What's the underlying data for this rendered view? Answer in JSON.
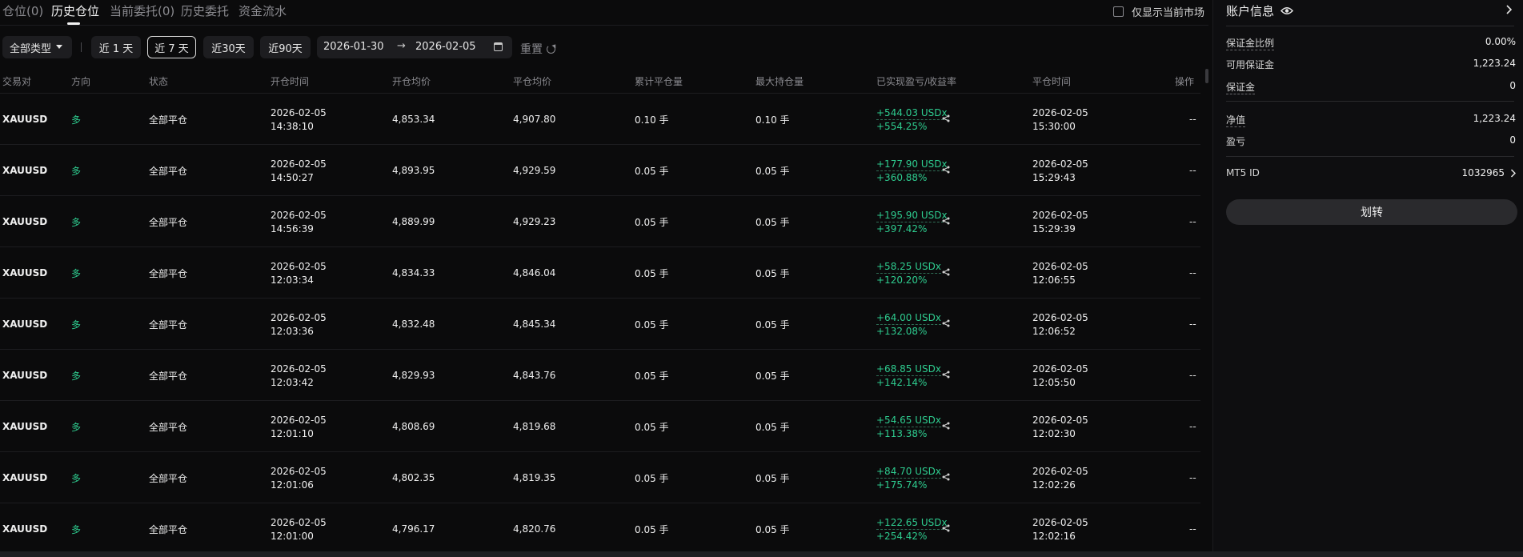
{
  "tabs": [
    {
      "label": "仓位(0)",
      "active": false
    },
    {
      "label": "历史仓位",
      "active": true
    },
    {
      "label": "当前委托(0)",
      "active": false
    },
    {
      "label": "历史委托",
      "active": false
    },
    {
      "label": "资金流水",
      "active": false
    }
  ],
  "only_current_market_label": "仅显示当前市场",
  "filters": {
    "type_select": "全部类型",
    "ranges": [
      "近 1 天",
      "近 7 天",
      "近30天",
      "近90天"
    ],
    "active_range": "近 7 天",
    "date_start": "2026-01-30",
    "date_end": "2026-02-05",
    "reset_label": "重置"
  },
  "table": {
    "headers": [
      "交易对",
      "方向",
      "状态",
      "开仓时间",
      "开仓均价",
      "平仓均价",
      "累计平仓量",
      "最大持仓量",
      "已实现盈亏/收益率",
      "平仓时间",
      "操作"
    ],
    "rows": [
      {
        "pair": "XAUUSD",
        "direction": "多",
        "status": "全部平仓",
        "open_date": "2026-02-05",
        "open_time": "14:38:10",
        "open_avg": "4,853.34",
        "close_avg": "4,907.80",
        "closed_qty": "0.10 手",
        "max_qty": "0.10 手",
        "pnl": "+544.03 USDx",
        "roi": "+554.25%",
        "close_date": "2026-02-05",
        "close_time": "15:30:00",
        "op": "--"
      },
      {
        "pair": "XAUUSD",
        "direction": "多",
        "status": "全部平仓",
        "open_date": "2026-02-05",
        "open_time": "14:50:27",
        "open_avg": "4,893.95",
        "close_avg": "4,929.59",
        "closed_qty": "0.05 手",
        "max_qty": "0.05 手",
        "pnl": "+177.90 USDx",
        "roi": "+360.88%",
        "close_date": "2026-02-05",
        "close_time": "15:29:43",
        "op": "--"
      },
      {
        "pair": "XAUUSD",
        "direction": "多",
        "status": "全部平仓",
        "open_date": "2026-02-05",
        "open_time": "14:56:39",
        "open_avg": "4,889.99",
        "close_avg": "4,929.23",
        "closed_qty": "0.05 手",
        "max_qty": "0.05 手",
        "pnl": "+195.90 USDx",
        "roi": "+397.42%",
        "close_date": "2026-02-05",
        "close_time": "15:29:39",
        "op": "--"
      },
      {
        "pair": "XAUUSD",
        "direction": "多",
        "status": "全部平仓",
        "open_date": "2026-02-05",
        "open_time": "12:03:34",
        "open_avg": "4,834.33",
        "close_avg": "4,846.04",
        "closed_qty": "0.05 手",
        "max_qty": "0.05 手",
        "pnl": "+58.25 USDx",
        "roi": "+120.20%",
        "close_date": "2026-02-05",
        "close_time": "12:06:55",
        "op": "--"
      },
      {
        "pair": "XAUUSD",
        "direction": "多",
        "status": "全部平仓",
        "open_date": "2026-02-05",
        "open_time": "12:03:36",
        "open_avg": "4,832.48",
        "close_avg": "4,845.34",
        "closed_qty": "0.05 手",
        "max_qty": "0.05 手",
        "pnl": "+64.00 USDx",
        "roi": "+132.08%",
        "close_date": "2026-02-05",
        "close_time": "12:06:52",
        "op": "--"
      },
      {
        "pair": "XAUUSD",
        "direction": "多",
        "status": "全部平仓",
        "open_date": "2026-02-05",
        "open_time": "12:03:42",
        "open_avg": "4,829.93",
        "close_avg": "4,843.76",
        "closed_qty": "0.05 手",
        "max_qty": "0.05 手",
        "pnl": "+68.85 USDx",
        "roi": "+142.14%",
        "close_date": "2026-02-05",
        "close_time": "12:05:50",
        "op": "--"
      },
      {
        "pair": "XAUUSD",
        "direction": "多",
        "status": "全部平仓",
        "open_date": "2026-02-05",
        "open_time": "12:01:10",
        "open_avg": "4,808.69",
        "close_avg": "4,819.68",
        "closed_qty": "0.05 手",
        "max_qty": "0.05 手",
        "pnl": "+54.65 USDx",
        "roi": "+113.38%",
        "close_date": "2026-02-05",
        "close_time": "12:02:30",
        "op": "--"
      },
      {
        "pair": "XAUUSD",
        "direction": "多",
        "status": "全部平仓",
        "open_date": "2026-02-05",
        "open_time": "12:01:06",
        "open_avg": "4,802.35",
        "close_avg": "4,819.35",
        "closed_qty": "0.05 手",
        "max_qty": "0.05 手",
        "pnl": "+84.70 USDx",
        "roi": "+175.74%",
        "close_date": "2026-02-05",
        "close_time": "12:02:26",
        "op": "--"
      },
      {
        "pair": "XAUUSD",
        "direction": "多",
        "status": "全部平仓",
        "open_date": "2026-02-05",
        "open_time": "12:01:00",
        "open_avg": "4,796.17",
        "close_avg": "4,820.76",
        "closed_qty": "0.05 手",
        "max_qty": "0.05 手",
        "pnl": "+122.65 USDx",
        "roi": "+254.42%",
        "close_date": "2026-02-05",
        "close_time": "12:02:16",
        "op": "--"
      }
    ]
  },
  "account": {
    "title": "账户信息",
    "margin_ratio_label": "保证金比例",
    "margin_ratio_value": "0.00%",
    "available_margin_label": "可用保证金",
    "available_margin_value": "1,223.24",
    "margin_label": "保证金",
    "margin_value": "0",
    "equity_label": "净值",
    "equity_value": "1,223.24",
    "pnl_label": "盈亏",
    "pnl_value": "0",
    "mt5_label": "MT5 ID",
    "mt5_value": "1032965",
    "transfer_label": "划转"
  },
  "colors": {
    "positive": "#2ecc8f",
    "background": "#0b0b0c",
    "panel": "#1d1d20"
  }
}
